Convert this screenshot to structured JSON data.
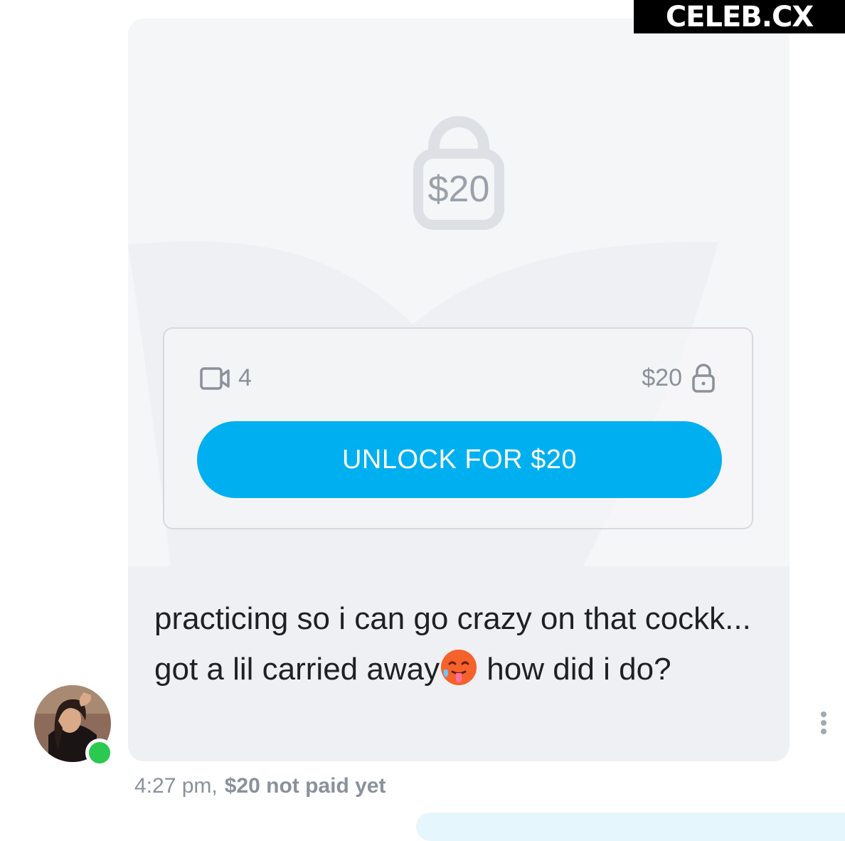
{
  "watermark": "CELEB.CX",
  "message": {
    "locked_media": {
      "big_lock_price": "$20",
      "media_count": "4",
      "price": "$20",
      "unlock_button_label": "UNLOCK FOR $20"
    },
    "text_before_emoji": "practicing so i can go crazy on that cockk... got a lil carried away",
    "text_after_emoji": " how did i do?",
    "emoji": "hot-face-emoji",
    "time": "4:27 pm,",
    "payment_status": "$20 not paid yet"
  },
  "icons": {
    "big_lock": "lock-icon",
    "video": "video-camera-icon",
    "small_lock": "lock-icon",
    "more": "vertical-dots-icon"
  },
  "colors": {
    "accent": "#00aff0",
    "online": "#2bc94f",
    "muted_text": "#8a919b"
  }
}
